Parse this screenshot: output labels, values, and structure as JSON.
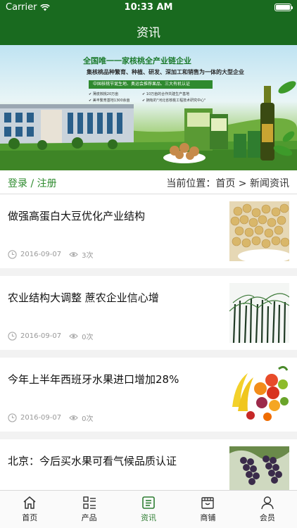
{
  "status_bar": {
    "carrier": "Carrier",
    "time": "10:33 AM"
  },
  "nav": {
    "title": "资讯"
  },
  "banner": {
    "headline": "全国唯一一家核桃全产业链企业",
    "subline": "集核桃品种繁育、种植、研发、深加工和销售为一体的大型企业",
    "strip": "中国核桃节诞生地、奥运会推荐果品、三大有机认证",
    "points_left": [
      "✔ 薄皮核桃20万亩",
      "✔ 美丰繁育基地1300余亩"
    ],
    "points_right": [
      "✔ 10万亩的合作共建生产基地",
      "✔ 拥有的\"河北省核桃工程技术研究中心\""
    ]
  },
  "breadcrumb": {
    "login": "登录",
    "separator": " / ",
    "register": "注册",
    "location": "当前位置：首页 > 新闻资讯"
  },
  "news": [
    {
      "title": "做强高蛋白大豆优化产业结构",
      "date": "2016-09-07",
      "views": "3次",
      "image": "soybeans"
    },
    {
      "title": "农业结构大调整 蔗农企业信心增",
      "date": "2016-09-07",
      "views": "0次",
      "image": "sugarcane"
    },
    {
      "title": "今年上半年西班牙水果进口增加28%",
      "date": "2016-09-07",
      "views": "0次",
      "image": "fruits"
    },
    {
      "title": "北京：今后买水果可看气候品质认证",
      "date": "",
      "views": "",
      "image": "grapes"
    }
  ],
  "tabs": [
    {
      "label": "首页",
      "icon": "home-icon"
    },
    {
      "label": "产品",
      "icon": "list-icon"
    },
    {
      "label": "资讯",
      "icon": "news-icon",
      "active": true
    },
    {
      "label": "商铺",
      "icon": "store-icon"
    },
    {
      "label": "会员",
      "icon": "user-icon"
    }
  ],
  "colors": {
    "primary": "#196a1f",
    "accent": "#2e8b2e"
  }
}
